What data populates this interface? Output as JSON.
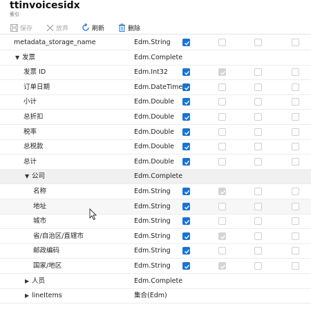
{
  "header": {
    "title": "ttinvoicesidx",
    "subtitle": "索引"
  },
  "toolbar": {
    "save": "保存",
    "discard": "放弃",
    "refresh": "刷新",
    "delete": "删除"
  },
  "rows": [
    {
      "name": "metadata_storage_name",
      "type": "Edm.String",
      "cb": [
        "on",
        "off",
        "off",
        "off"
      ]
    },
    {
      "name": "发票",
      "type": "Edm.Complete",
      "toggle": "▼",
      "cb": []
    },
    {
      "name": "发票 ID",
      "type": "Edm.Int32",
      "cb": [
        "on",
        "dim",
        "off",
        "off"
      ]
    },
    {
      "name": "订单日期",
      "type": "Edm.DateTime",
      "cb": [
        "on",
        "off",
        "off",
        "off"
      ]
    },
    {
      "name": "小计",
      "type": "Edm.Double",
      "cb": [
        "on",
        "off",
        "off",
        "off"
      ]
    },
    {
      "name": "总折扣",
      "type": "Edm.Double",
      "cb": [
        "on",
        "off",
        "off",
        "off"
      ]
    },
    {
      "name": "税率",
      "type": "Edm.Double",
      "cb": [
        "on",
        "off",
        "off",
        "off"
      ]
    },
    {
      "name": "总税款",
      "type": "Edm.Double",
      "cb": [
        "on",
        "off",
        "off",
        "off"
      ]
    },
    {
      "name": "总计",
      "type": "Edm.Double",
      "cb": [
        "on",
        "off",
        "off",
        "off"
      ]
    },
    {
      "name": "公司",
      "type": "Edm.Complete",
      "toggle": "▼",
      "cb": []
    },
    {
      "name": "名称",
      "type": "Edm.String",
      "cb": [
        "on",
        "dim",
        "off",
        "off"
      ]
    },
    {
      "name": "地址",
      "type": "Edm.String",
      "cb": [
        "on",
        "off",
        "off",
        "off"
      ]
    },
    {
      "name": "城市",
      "type": "Edm.String",
      "cb": [
        "on",
        "off",
        "off",
        "off"
      ]
    },
    {
      "name": "省/自治区/直辖市",
      "type": "Edm.String",
      "cb": [
        "on",
        "dim",
        "off",
        "off"
      ]
    },
    {
      "name": "邮政编码",
      "type": "Edm.String",
      "cb": [
        "on",
        "off",
        "off",
        "off"
      ]
    },
    {
      "name": "国家/地区",
      "type": "Edm.String",
      "cb": [
        "on",
        "dim",
        "off",
        "off"
      ]
    },
    {
      "name": "人员",
      "type": "Edm.Complete",
      "toggle": "▶",
      "cb": []
    },
    {
      "name": "lineItems",
      "type": "集合(Edm)",
      "toggle": "▶",
      "cb": []
    }
  ]
}
